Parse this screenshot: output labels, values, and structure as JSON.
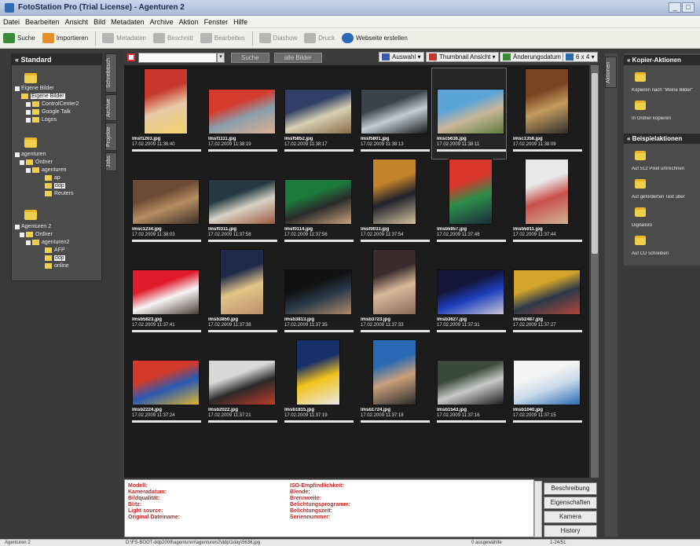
{
  "window": {
    "title": "FotoStation Pro (Trial License) - Agenturen 2"
  },
  "menu": [
    "Datei",
    "Bearbeiten",
    "Ansicht",
    "Bild",
    "Metadaten",
    "Archive",
    "Aktion",
    "Fenster",
    "Hilfe"
  ],
  "toolbar": {
    "search": "Suche",
    "import": "Importieren",
    "metadata": "Metadaten",
    "crop": "Beschnitt",
    "edit": "Bearbeiten",
    "slideshow": "Diashow",
    "print": "Druck",
    "website": "Webseite erstellen"
  },
  "left_panel": {
    "title": "Standard",
    "tree": [
      {
        "label": "Eigene Bilder",
        "level": 0
      },
      {
        "label": "Eigene Bilder",
        "level": 1,
        "selected": true
      },
      {
        "label": "ControlCenter2",
        "level": 1
      },
      {
        "label": "Google Talk",
        "level": 1
      },
      {
        "label": "Logos",
        "level": 1
      },
      {
        "label": "agenturen",
        "level": 0
      },
      {
        "label": "Ordner",
        "level": 1
      },
      {
        "label": "agenturen",
        "level": 2
      },
      {
        "label": "ap",
        "level": 3
      },
      {
        "label": "ddp",
        "level": 3,
        "selected": true
      },
      {
        "label": "Reuters",
        "level": 3
      },
      {
        "label": "Agenturen 2",
        "level": 0
      },
      {
        "label": "Ordner",
        "level": 1
      },
      {
        "label": "agenturen2",
        "level": 2
      },
      {
        "label": "AFP",
        "level": 3
      },
      {
        "label": "ddp",
        "level": 3,
        "selected": true
      },
      {
        "label": "online",
        "level": 3
      }
    ],
    "vtabs": [
      "Schreibtisch",
      "Archive",
      "Projekte",
      "Jobs"
    ]
  },
  "filter": {
    "search_button": "Suche",
    "all_images_button": "alle Bilder",
    "selection": "Auswahl",
    "view": "Thumbnail Ansicht",
    "sort": "Änderungsdatum",
    "grid": "6 x 4"
  },
  "thumbnails": [
    {
      "file": "lmsf1203.jpg",
      "date": "17.02.2009 11:36:40",
      "colors": [
        "#c8372d",
        "#e8c9a6",
        "#f1d36d"
      ]
    },
    {
      "file": "lmsf1111.jpg",
      "date": "17.02.2009 11:38:19",
      "colors": [
        "#d43b2d",
        "#8a9fae",
        "#e2b08f"
      ]
    },
    {
      "file": "lmsf5852.jpg",
      "date": "17.02.2009 11:38:17",
      "colors": [
        "#2f3f66",
        "#d6cfb2",
        "#8a6a46"
      ]
    },
    {
      "file": "lmsf5801.jpg",
      "date": "17.02.2009 11:38:13",
      "colors": [
        "#38434c",
        "#c2ccd2",
        "#171717"
      ]
    },
    {
      "file": "lmsc5636.jpg",
      "date": "17.02.2009 11:38:11",
      "colors": [
        "#5aa4d8",
        "#c9b79a",
        "#5d7a3a"
      ]
    },
    {
      "file": "lmsc1358.jpg",
      "date": "17.02.2009 11:38:09",
      "colors": [
        "#7a4322",
        "#c49b5f",
        "#2f2e2a"
      ]
    },
    {
      "file": "lmsc1234.jpg",
      "date": "17.02.2009 11:38:03",
      "colors": [
        "#6d4a33",
        "#b48d62",
        "#3d3026"
      ]
    },
    {
      "file": "lmsf0311.jpg",
      "date": "17.02.2009 11:37:58",
      "colors": [
        "#243942",
        "#d7d2c7",
        "#9c5a3b"
      ]
    },
    {
      "file": "lmsf0114.jpg",
      "date": "17.02.2009 11:37:56",
      "colors": [
        "#1c7a3d",
        "#2a2a2a",
        "#caa47e"
      ]
    },
    {
      "file": "lmsf0033.jpg",
      "date": "17.02.2009 11:37:54",
      "colors": [
        "#c4822a",
        "#20222b",
        "#d7c3a2"
      ]
    },
    {
      "file": "lmsb5957.jpg",
      "date": "17.02.2009 11:37:48",
      "colors": [
        "#d8362a",
        "#2c8e4a",
        "#1b2a3a"
      ]
    },
    {
      "file": "lmsb5911.jpg",
      "date": "17.02.2009 11:37:44",
      "colors": [
        "#e9e9ea",
        "#c9504a",
        "#d2b497"
      ]
    },
    {
      "file": "lmsb5823.jpg",
      "date": "17.02.2009 11:37:41",
      "colors": [
        "#e01a2a",
        "#f4f4f4",
        "#4a3e36"
      ]
    },
    {
      "file": "lmsb3850.jpg",
      "date": "17.02.2009 11:37:38",
      "colors": [
        "#1f2a4a",
        "#e2c587",
        "#b98f6b"
      ]
    },
    {
      "file": "lmsb3813.jpg",
      "date": "17.02.2009 11:37:35",
      "colors": [
        "#111",
        "#2a3a4a",
        "#b08a6a"
      ]
    },
    {
      "file": "lmsb3723.jpg",
      "date": "17.02.2009 11:37:33",
      "colors": [
        "#3a2c2c",
        "#d9b89a",
        "#8a6a5a"
      ]
    },
    {
      "file": "lmsb3627.jpg",
      "date": "17.02.2009 11:37:31",
      "colors": [
        "#14163a",
        "#1f3fbf",
        "#c9c9d5"
      ]
    },
    {
      "file": "lmsb2487.jpg",
      "date": "17.02.2009 11:37:27",
      "colors": [
        "#d4a32a",
        "#2a3a4a",
        "#b4453a"
      ]
    },
    {
      "file": "lmsb2224.jpg",
      "date": "17.02.2009 11:37:24",
      "colors": [
        "#d43a2a",
        "#2a5ab4",
        "#e0b42a"
      ]
    },
    {
      "file": "lmsb2022.jpg",
      "date": "17.02.2009 11:37:21",
      "colors": [
        "#d8d8d8",
        "#2a2a2a",
        "#c33a2a"
      ]
    },
    {
      "file": "lmsb1815.jpg",
      "date": "17.02.2009 11:37:19",
      "colors": [
        "#17306a",
        "#f2c21a",
        "#e9e9e9"
      ]
    },
    {
      "file": "lmsb1724.jpg",
      "date": "17.02.2009 11:37:18",
      "colors": [
        "#2a6ab4",
        "#c9a07a",
        "#2a2a2a"
      ]
    },
    {
      "file": "lmsb1543.jpg",
      "date": "17.02.2009 11:37:16",
      "colors": [
        "#3a4a3a",
        "#c9c9c9",
        "#1a1a1a"
      ]
    },
    {
      "file": "lmsb1040.jpg",
      "date": "17.02.2009 11:37:15",
      "colors": [
        "#f4f4f4",
        "#c9d9e9",
        "#2a6ab4"
      ]
    }
  ],
  "info": {
    "left_labels": [
      "Modell:",
      "Kameradatum:",
      "Bildqualität:",
      "Blitz:",
      "Light source:",
      "Original Dateiname:"
    ],
    "right_labels": [
      "ISO-Empfindlichkeit:",
      "Blende:",
      "Brennweite:",
      "Belichtungsprogramm:",
      "Belichtungszeit:",
      "Seriennummer:"
    ],
    "buttons": [
      "Beschreibung",
      "Eigenschaften",
      "Kamera",
      "History"
    ]
  },
  "right_panel": {
    "strip_label": "Aktionen",
    "section1": {
      "title": "Kopier-Aktionen",
      "items": [
        "Kopieren nach \"Meine Bilder\"",
        "In Ordner kopieren"
      ]
    },
    "section2": {
      "title": "Beispielaktionen",
      "items": [
        "Auf 512 Pixel umrechnen",
        "Auf geforderten Text über",
        "Digitalisto",
        "Auf CD schreiben"
      ]
    }
  },
  "status": {
    "left": "Agenturen 2",
    "path": "D:\\FS-BOOT-ddp2009\\agenturen\\agenturen2\\ddp\\1day\\5636.jpg",
    "selected": "0 ausgewählte",
    "count": "1-24/51"
  }
}
